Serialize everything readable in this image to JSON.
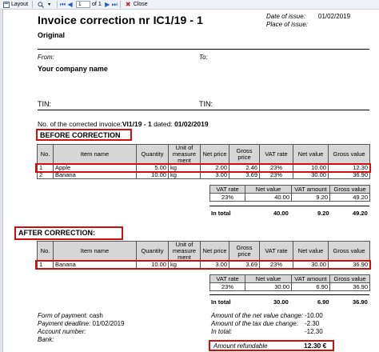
{
  "toolbar": {
    "layout_label": "Layout",
    "page_current": "1",
    "page_of": "of 1",
    "close_label": "Close"
  },
  "invoice": {
    "title": "Invoice correction  nr IC1/19 - 1",
    "subtitle": "Original",
    "date_of_issue_label": "Date of issue:",
    "date_of_issue_value": "01/02/2019",
    "place_of_issue_label": "Place of issue:",
    "from_label": "From:",
    "to_label": "To:",
    "company_name": "Your company name",
    "tin_left": "TIN:",
    "tin_right": "TIN:",
    "corrected_prefix": "No. of the corrected invoice:",
    "corrected_number": "VI1/19 - 1",
    "corrected_dated_label": " dated: ",
    "corrected_date": "01/02/2019"
  },
  "before": {
    "heading": "BEFORE CORRECTION",
    "headers": [
      "No.",
      "Item name",
      "Quantity",
      "Unit of measure ment",
      "Net price",
      "Gross price",
      "VAT rate",
      "Net value",
      "Gross value"
    ],
    "rows": [
      [
        "1",
        "Apple",
        "5.00",
        "kg",
        "2.00",
        "2.46",
        "23%",
        "10.00",
        "12.30"
      ],
      [
        "2",
        "Banana",
        "10.00",
        "kg",
        "3.00",
        "3.69",
        "23%",
        "30.00",
        "36.90"
      ]
    ],
    "vat_headers": [
      "VAT rate",
      "Net value",
      "VAT amount",
      "Gross value"
    ],
    "vat_row": [
      "23%",
      "40.00",
      "9.20",
      "49.20"
    ],
    "total_label": "In total",
    "totals": [
      "40.00",
      "9.20",
      "49.20"
    ]
  },
  "after": {
    "heading": "AFTER CORRECTION:",
    "headers": [
      "No.",
      "Item name",
      "Quantity",
      "Unit of measure ment",
      "Net price",
      "Gross price",
      "VAT rate",
      "Net value",
      "Gross value"
    ],
    "rows": [
      [
        "1",
        "Banana",
        "10.00",
        "kg",
        "3.00",
        "3.69",
        "23%",
        "30.00",
        "36.90"
      ]
    ],
    "vat_headers": [
      "VAT rate",
      "Net value",
      "VAT amount",
      "Gross value"
    ],
    "vat_row": [
      "23%",
      "30.00",
      "6.90",
      "36.90"
    ],
    "total_label": "In total",
    "totals": [
      "30.00",
      "6.90",
      "36.90"
    ]
  },
  "footer": {
    "payment_form_label": "Form of payment:",
    "payment_form_value": "cash",
    "payment_deadline_label": "Payment deadline:",
    "payment_deadline_value": "01/02/2019",
    "account_label": "Account number:",
    "bank_label": "Bank:",
    "net_change_label": "Amount of the net value change:",
    "net_change_value": "-10.00",
    "tax_change_label": "Amount of the tax due change:",
    "tax_change_value": "-2.30",
    "in_total_label": "In total:",
    "in_total_value": "-12.30",
    "refundable_label": "Amount refundable",
    "refundable_value": "12.30 €"
  },
  "colors": {
    "highlight": "#d10d0d",
    "header_gray": "#d6d6d6"
  }
}
